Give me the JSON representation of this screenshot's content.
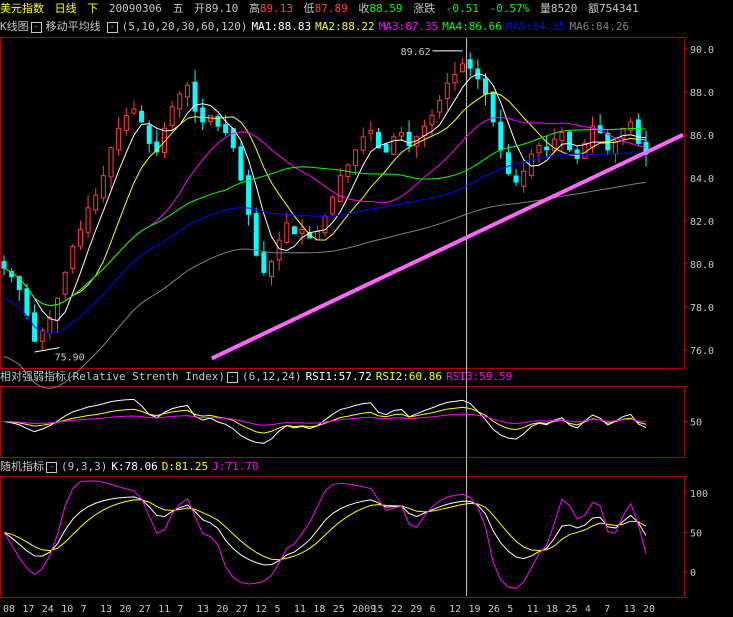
{
  "header": {
    "name": "美元指数",
    "period": "日线",
    "direction": "下",
    "date": "20090306",
    "weekday": "五",
    "open_label": "开",
    "open": "89.10",
    "high_label": "高",
    "high": "89.13",
    "low_label": "低",
    "low": "87.89",
    "close_label": "收",
    "close": "88.59",
    "change_label": "涨跌",
    "change": "-0.51",
    "change_pct": "-0.57%",
    "volume_label": "量",
    "volume": "8520",
    "amount_label": "额",
    "amount": "754341"
  },
  "kline_header": {
    "title": "K线图",
    "toggle": "-",
    "ma_title": "移动平均线",
    "ma_params": "(5,10,20,30,60,120)",
    "ma": [
      {
        "label": "MA1:88.83",
        "color": "#ffffff"
      },
      {
        "label": "MA2:88.22",
        "color": "#ffff00"
      },
      {
        "label": "MA3:87.35",
        "color": "#ff00ff"
      },
      {
        "label": "MA4:86.66",
        "color": "#00ff00"
      },
      {
        "label": "MA5:84.55",
        "color": "#0000ff"
      },
      {
        "label": "MA6:84.26",
        "color": "#808080"
      }
    ]
  },
  "rsi_header": {
    "title": "相对强弱指标(Relative Strenth Index)",
    "params": "(6,12,24)",
    "items": [
      {
        "label": "RSI1:57.72",
        "color": "#ffffff"
      },
      {
        "label": "RSI2:60.86",
        "color": "#ffff00"
      },
      {
        "label": "RSI3:59.59",
        "color": "#ff00ff"
      }
    ]
  },
  "kdj_header": {
    "title": "随机指标",
    "params": "(9,3,3)",
    "items": [
      {
        "label": "K:78.06",
        "color": "#ffffff"
      },
      {
        "label": "D:81.25",
        "color": "#ffff00"
      },
      {
        "label": "J:71.70",
        "color": "#ff00ff"
      }
    ]
  },
  "chart_data": {
    "type": "candlestick",
    "price_axis": {
      "ticks": [
        "90.0",
        "88.0",
        "86.0",
        "84.0",
        "82.0",
        "80.0",
        "78.0",
        "76.0"
      ],
      "range": [
        75.2,
        90.5
      ]
    },
    "annotations": {
      "high": "89.62",
      "low": "75.90"
    },
    "close": [
      79.8,
      79.4,
      78.8,
      77.6,
      76.4,
      76.9,
      77.5,
      78.4,
      79.6,
      80.8,
      81.6,
      82.6,
      83.2,
      84.1,
      85.4,
      86.3,
      86.9,
      87.2,
      86.6,
      85.6,
      85.2,
      86.3,
      87.3,
      87.9,
      88.3,
      87.1,
      86.6,
      86.9,
      86.4,
      86.1,
      85.4,
      83.9,
      82.3,
      80.4,
      79.6,
      80.1,
      81.1,
      81.9,
      81.4,
      81.6,
      81.2,
      81.5,
      82.2,
      83.1,
      84.1,
      84.6,
      85.3,
      85.9,
      86.2,
      85.4,
      85.2,
      85.9,
      86.1,
      85.5,
      85.9,
      86.4,
      86.9,
      87.6,
      88.4,
      88.8,
      89.3,
      89.1,
      88.6,
      87.9,
      86.6,
      85.3,
      84.2,
      83.8,
      84.3,
      85.1,
      85.5,
      85.3,
      85.8,
      86.1,
      85.3,
      84.9,
      85.6,
      86.4,
      86.1,
      85.3,
      85.7,
      86.3,
      86.6,
      85.6,
      85.1
    ],
    "ma_series": [
      "MA1",
      "MA2",
      "MA3",
      "MA4",
      "MA5",
      "MA6"
    ],
    "trendline": {
      "from": [
        0.31,
        75.6
      ],
      "to": [
        1.0,
        86.0
      ]
    },
    "rsi_axis": {
      "ticks": [
        "50"
      ],
      "range": [
        0,
        100
      ]
    },
    "kdj_axis": {
      "ticks": [
        "100",
        "50",
        "0"
      ],
      "range": [
        -30,
        120
      ]
    },
    "x_ticks": [
      "08",
      "17",
      "24",
      "10",
      "7",
      "13",
      "20",
      "27",
      "11",
      "7",
      "13",
      "20",
      "27",
      "12",
      "5",
      "11",
      "18",
      "25",
      "2009",
      "15",
      "22",
      "29",
      "6",
      "12",
      "19",
      "26",
      "5",
      "11",
      "18",
      "25",
      "4",
      "7",
      "13",
      "20"
    ]
  }
}
